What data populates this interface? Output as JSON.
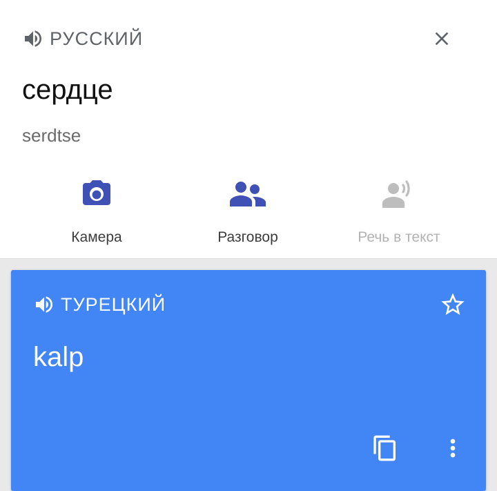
{
  "source": {
    "language": "РУССКИЙ",
    "text": "сердце",
    "transliteration": "serdtse",
    "speaker_icon": "speaker-icon",
    "close_icon": "close-icon"
  },
  "actions": [
    {
      "label": "Камера",
      "icon": "camera-icon",
      "enabled": true
    },
    {
      "label": "Разговор",
      "icon": "conversation-icon",
      "enabled": true
    },
    {
      "label": "Речь в текст",
      "icon": "speech-to-text-icon",
      "enabled": false
    }
  ],
  "translation": {
    "language": "ТУРЕЦКИЙ",
    "text": "kalp",
    "speaker_icon": "speaker-icon",
    "star_icon": "star-outline-icon",
    "copy_icon": "copy-icon",
    "more_icon": "more-vert-icon"
  },
  "colors": {
    "accent": "#3f51b5",
    "card": "#4285f4",
    "disabled": "#bdbdbd",
    "muted_text": "#5f6368"
  }
}
